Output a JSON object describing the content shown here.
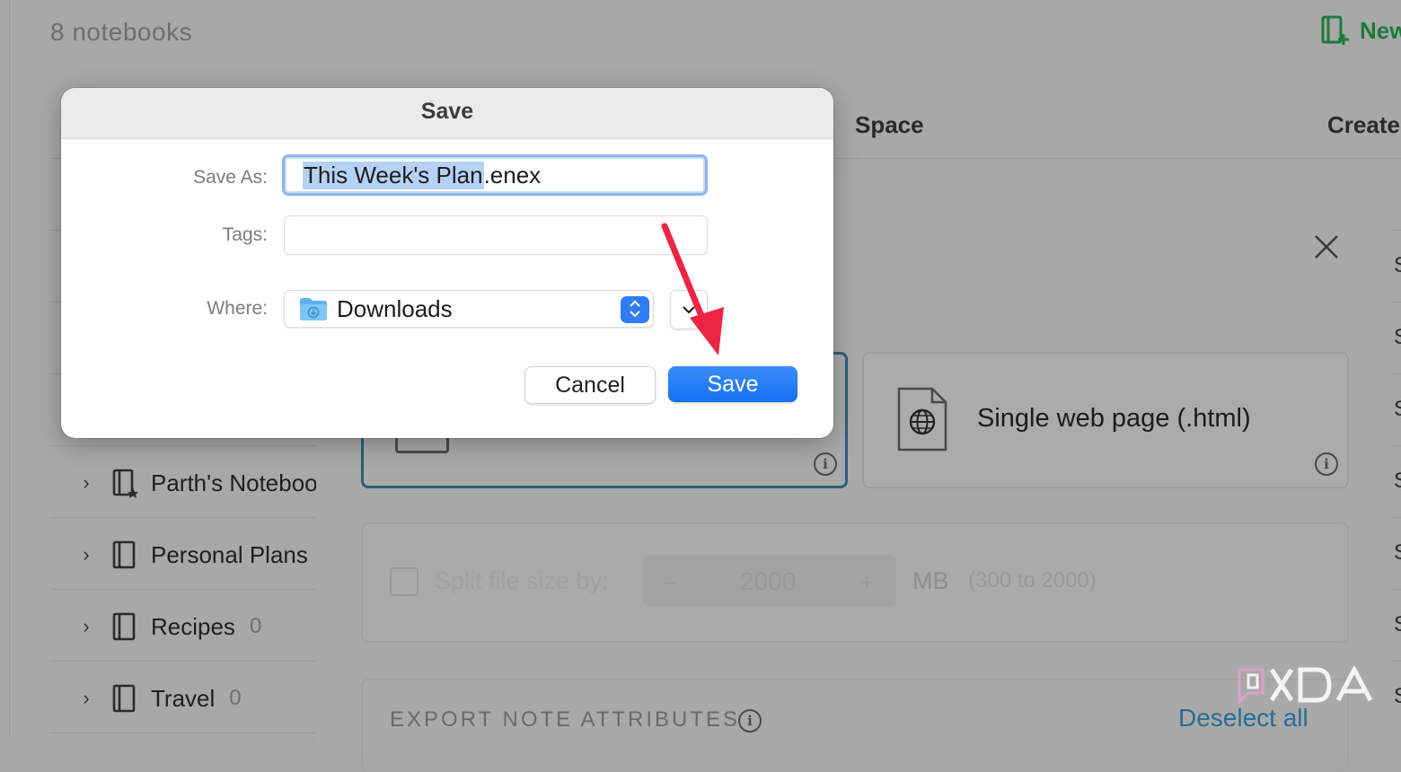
{
  "notebooks_page": {
    "count_label": "8 notebooks",
    "new_button_label": "New",
    "columns": {
      "space": "Space",
      "created": "Created"
    },
    "rows": [
      {
        "name": "Parth's Notebook",
        "count": ""
      },
      {
        "name": "Personal Plans",
        "count": ""
      },
      {
        "name": "Recipes",
        "count": "0"
      },
      {
        "name": "Travel",
        "count": "0"
      }
    ],
    "right_edge_glyph": "S"
  },
  "export_modal": {
    "html_option_label": "Single web page (.html)",
    "split": {
      "label": "Split file size by:",
      "minus": "−",
      "value": "2000",
      "plus": "+",
      "unit": "MB",
      "range": "(300 to 2000)"
    },
    "attributes_label": "EXPORT NOTE ATTRIBUTES",
    "deselect_all": "Deselect all",
    "info_glyph": "i"
  },
  "save_dialog": {
    "title": "Save",
    "save_as_label": "Save As:",
    "filename_selected": "This Week's Plan",
    "filename_ext": ".enex",
    "tags_label": "Tags:",
    "tags_value": "",
    "where_label": "Where:",
    "where_value": "Downloads",
    "stepper_glyph": "⌃⌄",
    "expand_glyph": "⌄",
    "cancel_label": "Cancel",
    "save_label": "Save"
  },
  "colors": {
    "primary_button": "#1671f2",
    "focus_ring": "#8fb5ea",
    "annotation_arrow": "#ee2443",
    "new_button": "#1e7a3a"
  },
  "watermark": "XDA"
}
